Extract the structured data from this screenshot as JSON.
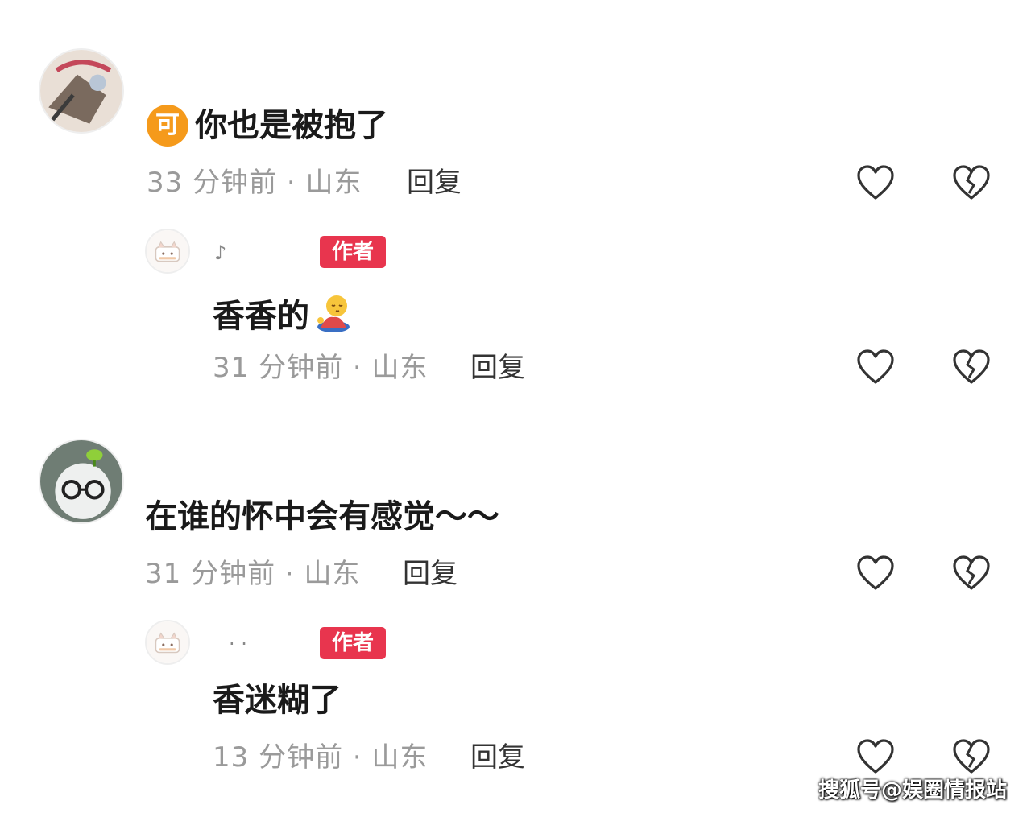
{
  "colors": {
    "author_badge": "#e8354e",
    "level_badge": "#f59a1b",
    "meta_gray": "#9a9a9a",
    "icon_stroke": "#333333"
  },
  "icons": {
    "like": "heart-outline-icon",
    "dislike": "broken-heart-icon",
    "emoji": "sleepy-emoji-icon"
  },
  "comments": [
    {
      "level_badge": "可",
      "text": "你也是被抱了",
      "time": "33 分钟前 · 山东",
      "reply_label": "回复",
      "reply": {
        "nickname": "♪",
        "author_badge": "作者",
        "text": "香香的",
        "time": "31 分钟前 · 山东",
        "reply_label": "回复"
      }
    },
    {
      "text": "在谁的怀中会有感觉～～",
      "time": "31 分钟前 · 山东",
      "reply_label": "回复",
      "reply": {
        "nickname": "· ·",
        "author_badge": "作者",
        "text": "香迷糊了",
        "time": "13 分钟前 · 山东",
        "reply_label": "回复"
      }
    }
  ],
  "watermark": "搜狐号@娱圈情报站"
}
